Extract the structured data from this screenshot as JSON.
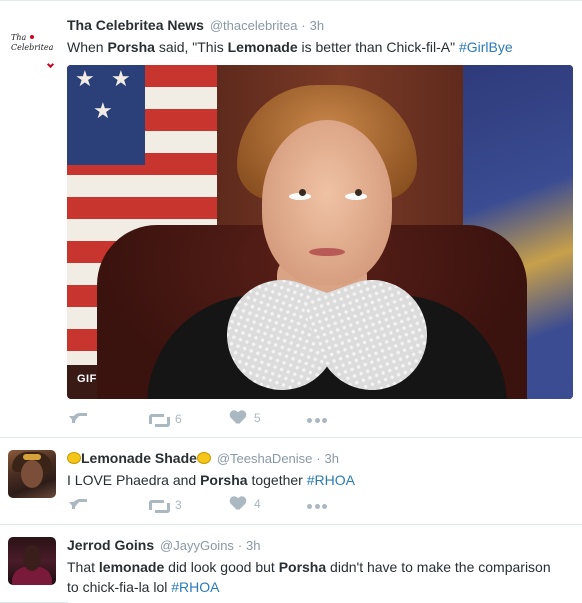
{
  "tweets": [
    {
      "fullname": "Tha Celebritea News",
      "username": "@thacelebritea",
      "time": "3h",
      "text_parts": [
        "When ",
        "Porsha",
        " said, \"This ",
        "Lemonade",
        " is better than Chick-fil-A\" ",
        "#GirlBye"
      ],
      "avatar_logo": "Tha Celebritea",
      "media_badge": "GIF",
      "retweets": "6",
      "likes": "5"
    },
    {
      "fullname": "Lemonade Shade",
      "username": "@TeeshaDenise",
      "time": "3h",
      "text_parts": [
        "I LOVE Phaedra and ",
        "Porsha",
        " together ",
        "#RHOA"
      ],
      "retweets": "3",
      "likes": "4"
    },
    {
      "fullname": "Jerrod Goins",
      "username": "@JayyGoins",
      "time": "3h",
      "text_parts": [
        "That ",
        "lemonade",
        " did look good but ",
        "Porsha",
        " didn't have to make the comparison",
        "to chick-fia-la lol ",
        "#RHOA"
      ]
    }
  ],
  "separator": "·",
  "icons": {
    "reply": "reply-icon",
    "retweet": "retweet-icon",
    "like": "heart-icon",
    "more": "more-icon",
    "emoji": "lemon-emoji-icon"
  },
  "colors": {
    "link": "#2b7bb9",
    "meta": "#8899a6",
    "action": "#aab8c2",
    "text": "#292f33"
  }
}
